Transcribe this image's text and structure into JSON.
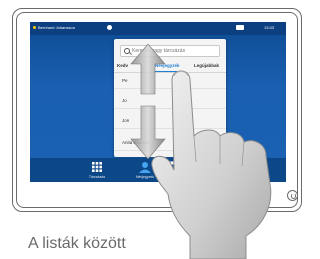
{
  "statusbar": {
    "user_name": "Bernhard Johansson",
    "time": "13:33"
  },
  "directory": {
    "search_placeholder": "Keresés vagy tárcsázás",
    "tabs": [
      {
        "label": "Kedv"
      },
      {
        "label": "Névjegyzék",
        "active": true
      },
      {
        "label": "Legújabbak"
      }
    ],
    "rows": [
      {
        "label": "Pe"
      },
      {
        "label": "Jo"
      },
      {
        "label": "Jon"
      },
      {
        "label": "Anita Poscotti"
      }
    ]
  },
  "dock": {
    "items": [
      {
        "label": "Tárcsázás",
        "icon": "keypad-icon"
      },
      {
        "label": "Névjegyzék",
        "icon": "person-icon"
      },
      {
        "label": "Ütemezett",
        "icon": "calendar-icon"
      }
    ]
  },
  "caption": "A listák között",
  "colors": {
    "screen_blue": "#1a5fb0",
    "accent": "#1f7fd4"
  }
}
